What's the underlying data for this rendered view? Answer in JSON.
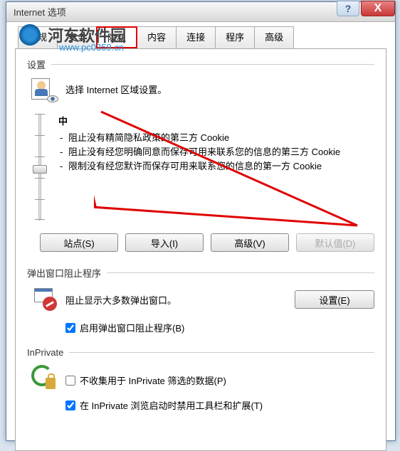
{
  "window": {
    "title": "Internet 选项"
  },
  "watermark": {
    "text": "河东软件园",
    "url": "www.pc0359.cn"
  },
  "tabs": {
    "items": [
      {
        "label": "常规",
        "active": false
      },
      {
        "label": "安全",
        "active": false
      },
      {
        "label": "隐私",
        "active": true,
        "highlighted": true
      },
      {
        "label": "内容",
        "active": false
      },
      {
        "label": "连接",
        "active": false
      },
      {
        "label": "程序",
        "active": false
      },
      {
        "label": "高级",
        "active": false
      }
    ]
  },
  "settings": {
    "group_label": "设置",
    "description": "选择 Internet 区域设置。",
    "slider": {
      "level": "中",
      "bullets": [
        "阻止没有精简隐私政策的第三方 Cookie",
        "阻止没有经您明确同意而保存可用来联系您的信息的第三方 Cookie",
        "限制没有经您默许而保存可用来联系您的信息的第一方 Cookie"
      ]
    },
    "buttons": {
      "sites": "站点(S)",
      "import": "导入(I)",
      "advanced": "高级(V)",
      "default": "默认值(D)"
    }
  },
  "popup": {
    "group_label": "弹出窗口阻止程序",
    "description": "阻止显示大多数弹出窗口。",
    "settings_button": "设置(E)",
    "checkbox_label": "启用弹出窗口阻止程序(B)",
    "checkbox_checked": true
  },
  "inprivate": {
    "group_label": "InPrivate",
    "collect_label": "不收集用于 InPrivate 筛选的数据(P)",
    "collect_checked": false,
    "disable_label": "在 InPrivate 浏览启动时禁用工具栏和扩展(T)",
    "disable_checked": true
  }
}
